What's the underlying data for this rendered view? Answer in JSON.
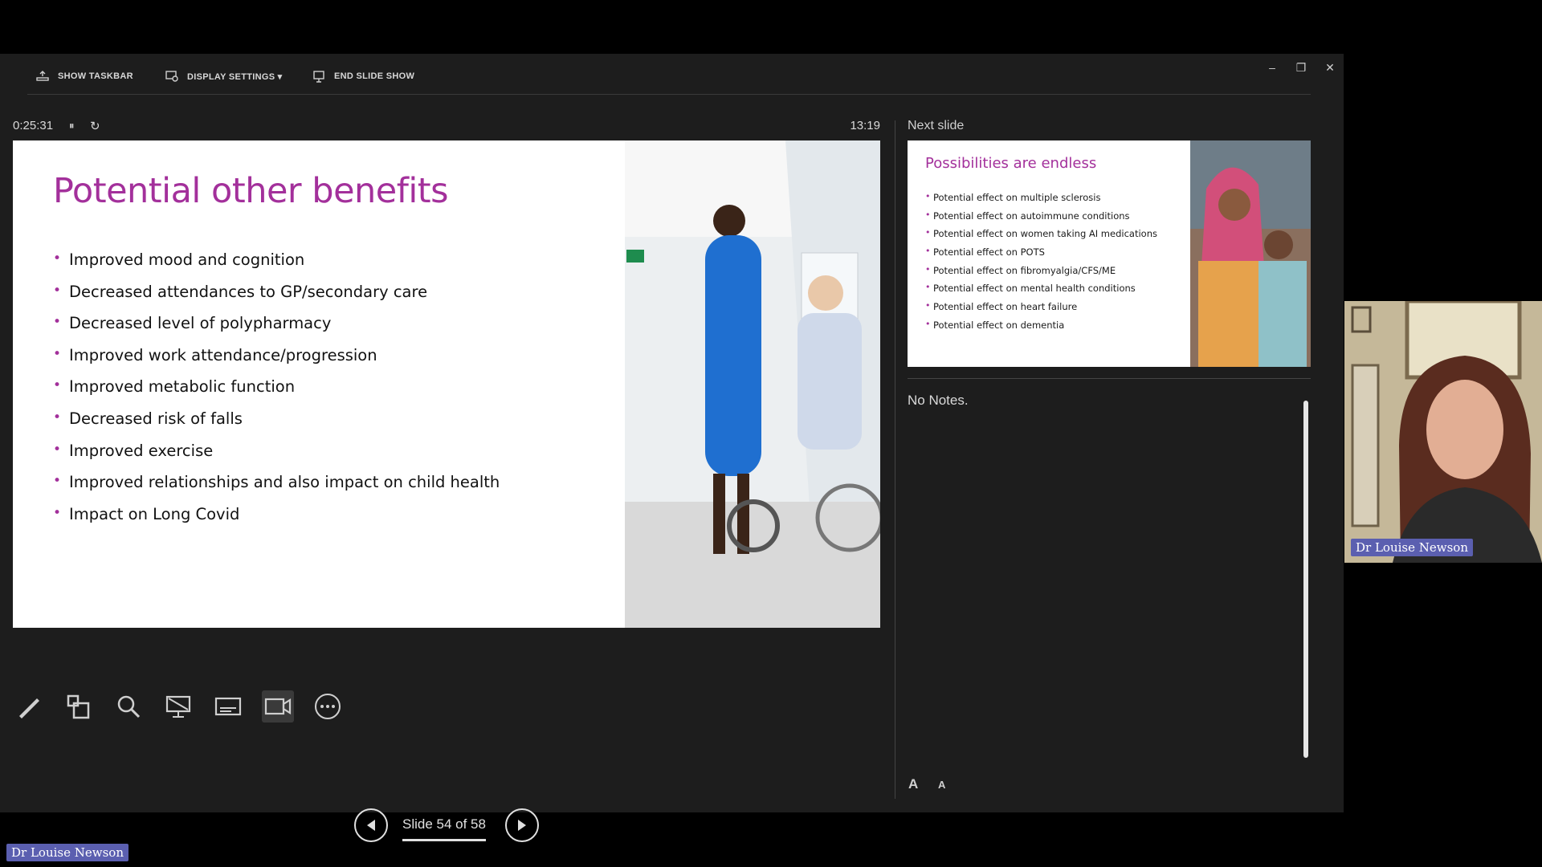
{
  "toolbar": {
    "show_taskbar": "SHOW TASKBAR",
    "display_settings": "DISPLAY SETTINGS ▾",
    "end_slide_show": "END SLIDE SHOW"
  },
  "window_controls": {
    "minimize": "–",
    "restore": "❐",
    "close": "✕"
  },
  "timer": {
    "elapsed": "0:25:31",
    "pause_icon": "⏸",
    "reset_icon": "↻",
    "clock": "13:19"
  },
  "current_slide": {
    "title": "Potential other benefits",
    "bullets": [
      "Improved mood and cognition",
      "Decreased attendances to GP/secondary care",
      "Decreased level of polypharmacy",
      "Improved work attendance/progression",
      "Improved metabolic function",
      "Decreased risk of falls",
      "Improved exercise",
      "Improved relationships and also impact on child health",
      "Impact on Long Covid"
    ]
  },
  "slide_tools": [
    "pen-icon",
    "see-all-slides-icon",
    "zoom-icon",
    "black-screen-icon",
    "subtitles-icon",
    "camera-icon",
    "more-options-icon"
  ],
  "navigation": {
    "counter": "Slide 54 of 58"
  },
  "next_slide": {
    "label": "Next slide",
    "title": "Possibilities are endless",
    "bullets": [
      "Potential effect on multiple sclerosis",
      "Potential effect on autoimmune conditions",
      "Potential effect on women taking AI medications",
      "Potential effect on POTS",
      "Potential effect on fibromyalgia/CFS/ME",
      "Potential effect on mental health conditions",
      "Potential effect on heart failure",
      "Potential effect on dementia"
    ]
  },
  "notes": {
    "text": "No Notes.",
    "font_up": "A",
    "font_down": "A"
  },
  "participant": {
    "name": "Dr Louise Newson"
  },
  "colors": {
    "accent": "#a3309b",
    "name_tag": "#5b5fb0",
    "window_bg": "#1d1d1d"
  }
}
